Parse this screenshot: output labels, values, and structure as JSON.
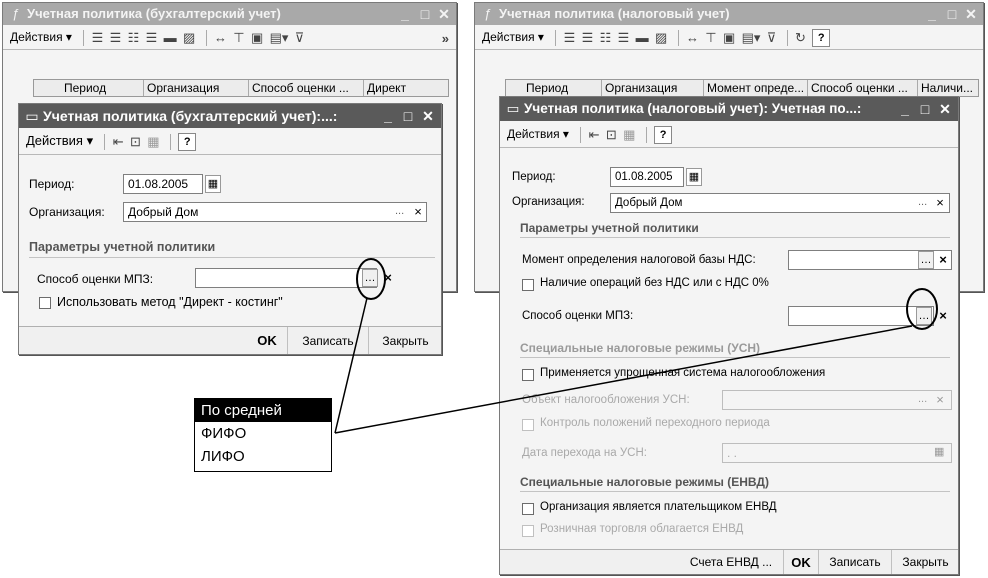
{
  "accounting_list": {
    "title": "Учетная политика (бухгалтерский учет)",
    "actions_label": "Действия",
    "columns": [
      "Период",
      "Организация",
      "Способ оценки ...",
      "Директ"
    ]
  },
  "tax_list": {
    "title": "Учетная политика (налоговый учет)",
    "actions_label": "Действия",
    "columns": [
      "Период",
      "Организация",
      "Момент опреде...",
      "Способ оценки ...",
      "Наличи..."
    ]
  },
  "accounting_form": {
    "title": "Учетная политика (бухгалтерский учет):...:",
    "actions_label": "Действия",
    "period_label": "Период:",
    "period_value": "01.08.2005",
    "org_label": "Организация:",
    "org_value": "Добрый Дом",
    "group_title": "Параметры учетной политики",
    "mpz_label": "Способ оценки МПЗ:",
    "mpz_value": "",
    "direct_costing_label": "Использовать метод \"Директ - костинг\"",
    "ok_label": "OK",
    "save_label": "Записать",
    "close_label": "Закрыть"
  },
  "tax_form": {
    "title": "Учетная политика (налоговый учет): Учетная по...:",
    "actions_label": "Действия",
    "period_label": "Период:",
    "period_value": "01.08.2005",
    "org_label": "Организация:",
    "org_value": "Добрый Дом",
    "group1_title": "Параметры учетной политики",
    "vat_moment_label": "Момент определения налоговой базы НДС:",
    "vat_moment_value": "",
    "no_vat_ops_label": "Наличие операций без НДС или с НДС 0%",
    "mpz_label": "Способ оценки МПЗ:",
    "mpz_value": "",
    "group2_title": "Специальные налоговые режимы (УСН)",
    "usn_label": "Применяется упрощенная система налогообложения",
    "usn_object_label": "Объект налогообложения УСН:",
    "transition_control_label": "Контроль положений переходного периода",
    "transition_date_label": "Дата перехода на УСН:",
    "transition_date_value": " .  .",
    "group3_title": "Специальные налоговые режимы (ЕНВД)",
    "envd_payer_label": "Организация является плательщиком ЕНВД",
    "retail_envd_label": "Розничная торговля облагается ЕНВД",
    "accounts_label": "Счета ЕНВД ...",
    "ok_label": "OK",
    "save_label": "Записать",
    "close_label": "Закрыть"
  },
  "dropdown": {
    "options": [
      "По средней",
      "ФИФО",
      "ЛИФО"
    ],
    "selected": "По средней"
  }
}
